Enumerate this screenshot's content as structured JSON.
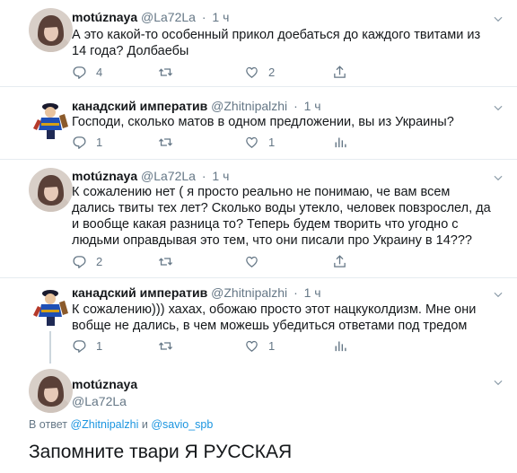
{
  "tweets": [
    {
      "name": "motúznaya",
      "handle": "@La72La",
      "sep": "·",
      "time": "1 ч",
      "text": "А это какой-то особенный прикол доебаться до каждого твитами из 14 года? Долбаебы",
      "counts": {
        "reply": "4",
        "retweet": "",
        "like": "2"
      }
    },
    {
      "name": "канадский императив",
      "handle": "@Zhitnipalzhi",
      "sep": "·",
      "time": "1 ч",
      "text": "Господи, сколько матов в одном предложении, вы из Украины?",
      "counts": {
        "reply": "1",
        "retweet": "",
        "like": "1"
      }
    },
    {
      "name": "motúznaya",
      "handle": "@La72La",
      "sep": "·",
      "time": "1 ч",
      "text": "К сожалению нет ( я просто реально не понимаю, че вам всем дались твиты тех лет? Сколько воды утекло, человек повзрослел, да и вообще какая разница то? Теперь будем творить что угодно с людьми оправдывая это тем, что они писали про Украину в 14???",
      "counts": {
        "reply": "2",
        "retweet": "",
        "like": ""
      }
    },
    {
      "name": "канадский императив",
      "handle": "@Zhitnipalzhi",
      "sep": "·",
      "time": "1 ч",
      "text": "К сожалению))) хахах, обожаю просто этот нацкуколдизм. Мне они вобще не дались, в чем можешь убедиться ответами под тредом",
      "counts": {
        "reply": "1",
        "retweet": "",
        "like": "1"
      }
    }
  ],
  "main": {
    "name": "motúznaya",
    "handle": "@La72La",
    "reply_prefix": "В ответ",
    "reply_user1": "@Zhitnipalzhi",
    "reply_and": "и",
    "reply_user2": "@savio_spb",
    "text": "Запомните твари Я РУССКАЯ"
  },
  "colors": {
    "muted": "#657786",
    "link": "#1b95e0",
    "text": "#14171a"
  }
}
